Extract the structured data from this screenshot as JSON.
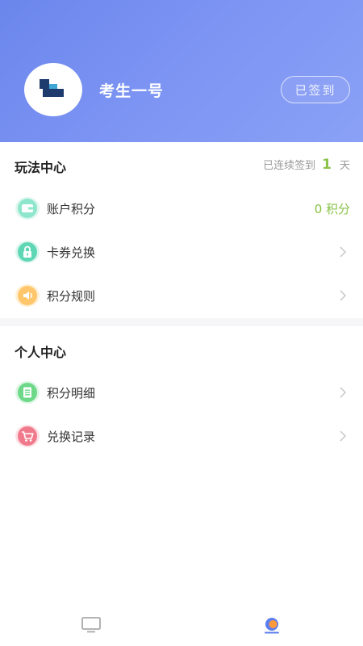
{
  "profile": {
    "username": "考生一号",
    "signed_label": "已签到"
  },
  "play_center": {
    "title": "玩法中心",
    "streak_prefix": "已连续签到",
    "streak_days": "1",
    "streak_suffix": "天",
    "items": [
      {
        "label": "账户积分",
        "value": "0 积分",
        "icon": "wallet-icon",
        "color": "#7ee0c4"
      },
      {
        "label": "卡券兑换",
        "icon": "lock-icon",
        "color": "#5fd6b4"
      },
      {
        "label": "积分规则",
        "icon": "speaker-icon",
        "color": "#ffc66b"
      }
    ]
  },
  "personal_center": {
    "title": "个人中心",
    "items": [
      {
        "label": "积分明细",
        "icon": "document-icon",
        "color": "#6ed889"
      },
      {
        "label": "兑换记录",
        "icon": "cart-icon",
        "color": "#f07a8c"
      }
    ]
  },
  "tabbar": {
    "tabs": [
      {
        "icon": "monitor-icon"
      },
      {
        "icon": "profile-icon",
        "active_color": "#5b7ef0"
      }
    ]
  }
}
